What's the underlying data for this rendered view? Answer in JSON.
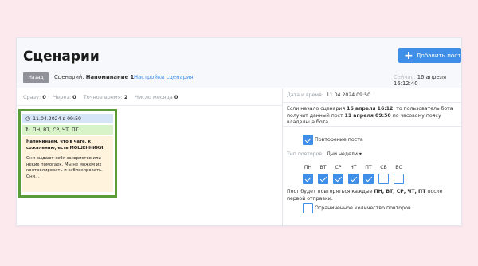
{
  "header": {
    "title": "Сценарии",
    "add_button": "Добавить пост",
    "back_button": "Назад",
    "scenario_label": "Сценарий:",
    "scenario_name": "Напоминание 1",
    "settings_link": "Настройки сценария",
    "now_label": "Сейчас:",
    "now_value": "16 апреля 16:12:40"
  },
  "stats": [
    {
      "label": "Сразу:",
      "value": "0"
    },
    {
      "label": "Через:",
      "value": "0"
    },
    {
      "label": "Точное время:",
      "value": "2"
    },
    {
      "label": "Число месяца",
      "value": "0"
    }
  ],
  "post": {
    "date": "11.04.2024 в 09:50",
    "days": "ПН, ВТ, СР, ЧТ, ПТ",
    "bold_text": "Напоминаем, что в чате, к сожалению, есть МОШЕННИКИ",
    "body_text": "Они выдают себя за юристов или неких помогаек. Мы не можем их контролировать и заблокировать. Они..."
  },
  "details": {
    "date_label": "Дата и время:",
    "date_value": "11.04.2024 09:50",
    "info_1": "Если начало сценария ",
    "info_2": "16 апреля 16:12",
    "info_3": ", то пользователь бота получит данный пост ",
    "info_4": "11 апреля 09:50",
    "info_5": " по часовому поясу владельца бота.",
    "repeat_label": "Повторение поста",
    "repeat_checked": true,
    "repeat_type_label": "Тип повторов:",
    "repeat_type_value": "Дни недели",
    "days": [
      {
        "label": "ПН",
        "checked": true
      },
      {
        "label": "ВТ",
        "checked": true
      },
      {
        "label": "СР",
        "checked": true
      },
      {
        "label": "ЧТ",
        "checked": true
      },
      {
        "label": "ПТ",
        "checked": true
      },
      {
        "label": "СБ",
        "checked": false
      },
      {
        "label": "ВС",
        "checked": false
      }
    ],
    "note_1": "Пост будет повторяться каждые ",
    "note_2": "ПН, ВТ, СР, ЧТ, ПТ",
    "note_3": " после первой отправки.",
    "limit_label": "Ограниченное количество повторов",
    "limit_checked": false
  },
  "colors": {
    "accent": "#3f8ee8",
    "background": "#fbe9ee",
    "highlight_border": "#5a9c3a"
  }
}
